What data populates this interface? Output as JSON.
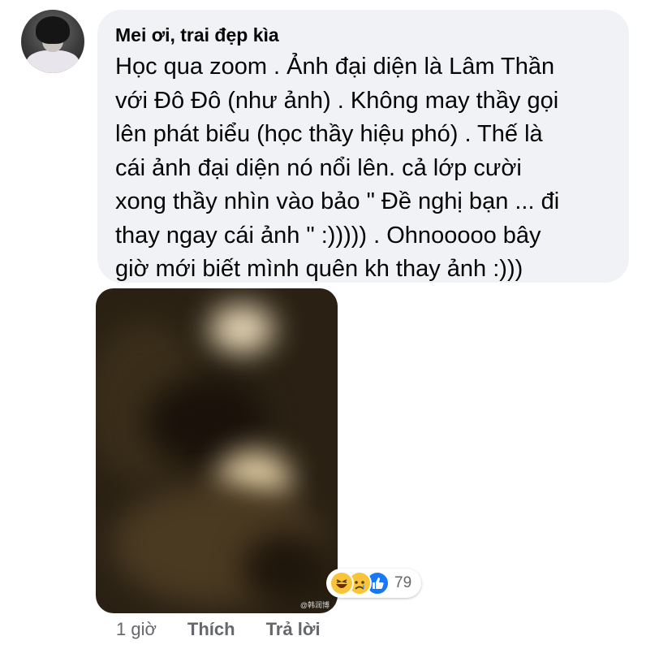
{
  "comment": {
    "author": "Mei ơi, trai đẹp kìa",
    "text": "Học qua zoom . Ảnh đại diện là Lâm Thần\nvới Đô Đô (như ảnh) . Không may thầy gọi\nlên phát biểu (học thầy hiệu phó) . Thế là\ncái ảnh đại diện nó nổi lên.   cả lớp cười\nxong thầy nhìn vào bảo \" Đề nghị bạn ... đi\nthay ngay cái ảnh \" :))))) . Ohnooooo bây\ngiờ mới biết mình quên kh thay ảnh :)))"
  },
  "attachment": {
    "watermark": "@韩润博"
  },
  "reactions": {
    "icons": [
      "haha-icon",
      "sad-icon",
      "like-icon"
    ],
    "count": "79"
  },
  "actions": {
    "time": "1 giờ",
    "like": "Thích",
    "reply": "Trả lời"
  },
  "colors": {
    "bubble_bg": "#f0f2f5",
    "secondary_text": "#65676b",
    "like_blue": "#1877f2"
  }
}
